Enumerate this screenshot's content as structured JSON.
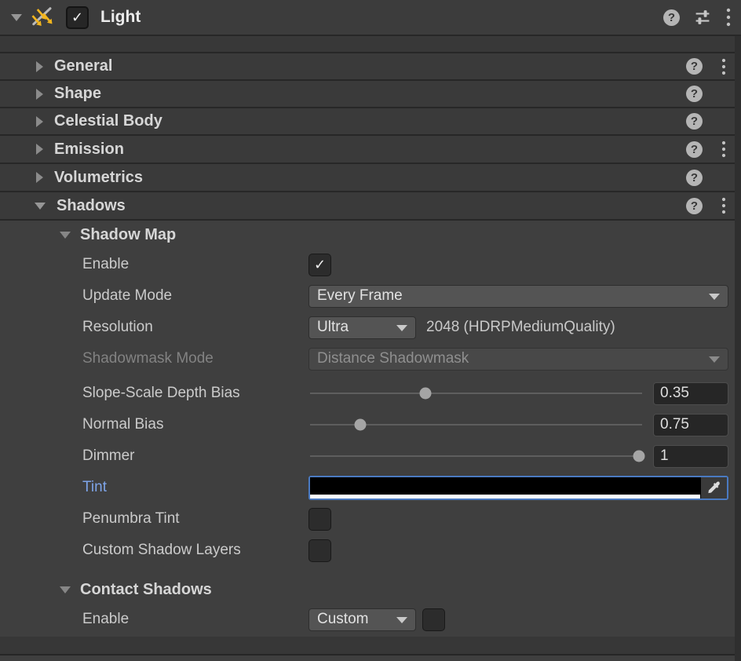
{
  "component_header": {
    "title": "Light",
    "enabled": true
  },
  "icons": {
    "help": "?",
    "check": "✓"
  },
  "sections": [
    {
      "label": "General",
      "has_menu": true
    },
    {
      "label": "Shape",
      "has_menu": false
    },
    {
      "label": "Celestial Body",
      "has_menu": false
    },
    {
      "label": "Emission",
      "has_menu": true
    },
    {
      "label": "Volumetrics",
      "has_menu": false
    }
  ],
  "shadows_section": {
    "label": "Shadows",
    "has_menu": true
  },
  "shadow_map": {
    "title": "Shadow Map",
    "enable": {
      "label": "Enable",
      "checked": true
    },
    "update_mode": {
      "label": "Update Mode",
      "value": "Every Frame"
    },
    "resolution": {
      "label": "Resolution",
      "value": "Ultra",
      "suffix": "2048 (HDRPMediumQuality)"
    },
    "shadowmask_mode": {
      "label": "Shadowmask Mode",
      "value": "Distance Shadowmask",
      "disabled": true
    },
    "slope_scale_depth_bias": {
      "label": "Slope-Scale Depth Bias",
      "value": "0.35",
      "fraction": 0.35
    },
    "normal_bias": {
      "label": "Normal Bias",
      "value": "0.75",
      "fraction": 0.155
    },
    "dimmer": {
      "label": "Dimmer",
      "value": "1",
      "fraction": 0.985
    },
    "tint": {
      "label": "Tint",
      "color": "#000000",
      "alpha_color": "#ffffff"
    },
    "penumbra_tint": {
      "label": "Penumbra Tint",
      "checked": false
    },
    "custom_shadow_layers": {
      "label": "Custom Shadow Layers",
      "checked": false
    }
  },
  "contact_shadows": {
    "title": "Contact Shadows",
    "enable": {
      "label": "Enable",
      "value": "Custom",
      "checked": false
    }
  },
  "colors": {
    "accent_focus": "#4a7ac2",
    "modified_label": "#7ea4e8",
    "light_icon_yellow": "#f3b61e"
  }
}
